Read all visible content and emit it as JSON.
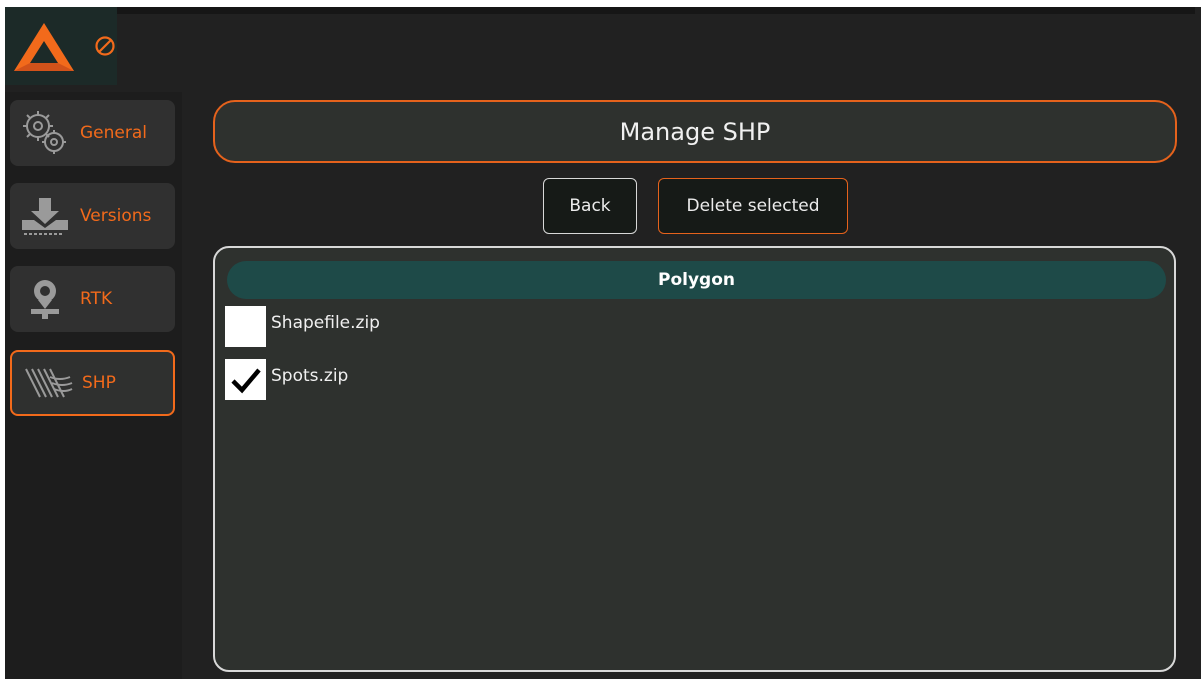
{
  "header": {
    "logo_icon": "app-triangle-logo-icon",
    "status_icon": "prohibited-icon"
  },
  "sidebar": {
    "items": [
      {
        "label": "General",
        "icon": "gears-icon",
        "active": false
      },
      {
        "label": "Versions",
        "icon": "download-tray-icon",
        "active": false
      },
      {
        "label": "RTK",
        "icon": "location-pin-icon",
        "active": false
      },
      {
        "label": "SHP",
        "icon": "field-rows-icon",
        "active": true
      }
    ]
  },
  "main": {
    "title": "Manage SHP",
    "buttons": {
      "back": "Back",
      "delete_selected": "Delete selected"
    },
    "list": {
      "header": "Polygon",
      "items": [
        {
          "name": "Shapefile.zip",
          "checked": false
        },
        {
          "name": "Spots.zip",
          "checked": true
        }
      ]
    }
  },
  "colors": {
    "accent": "#f26a1b",
    "background": "#212121",
    "header_teal": "#1e4a48"
  }
}
